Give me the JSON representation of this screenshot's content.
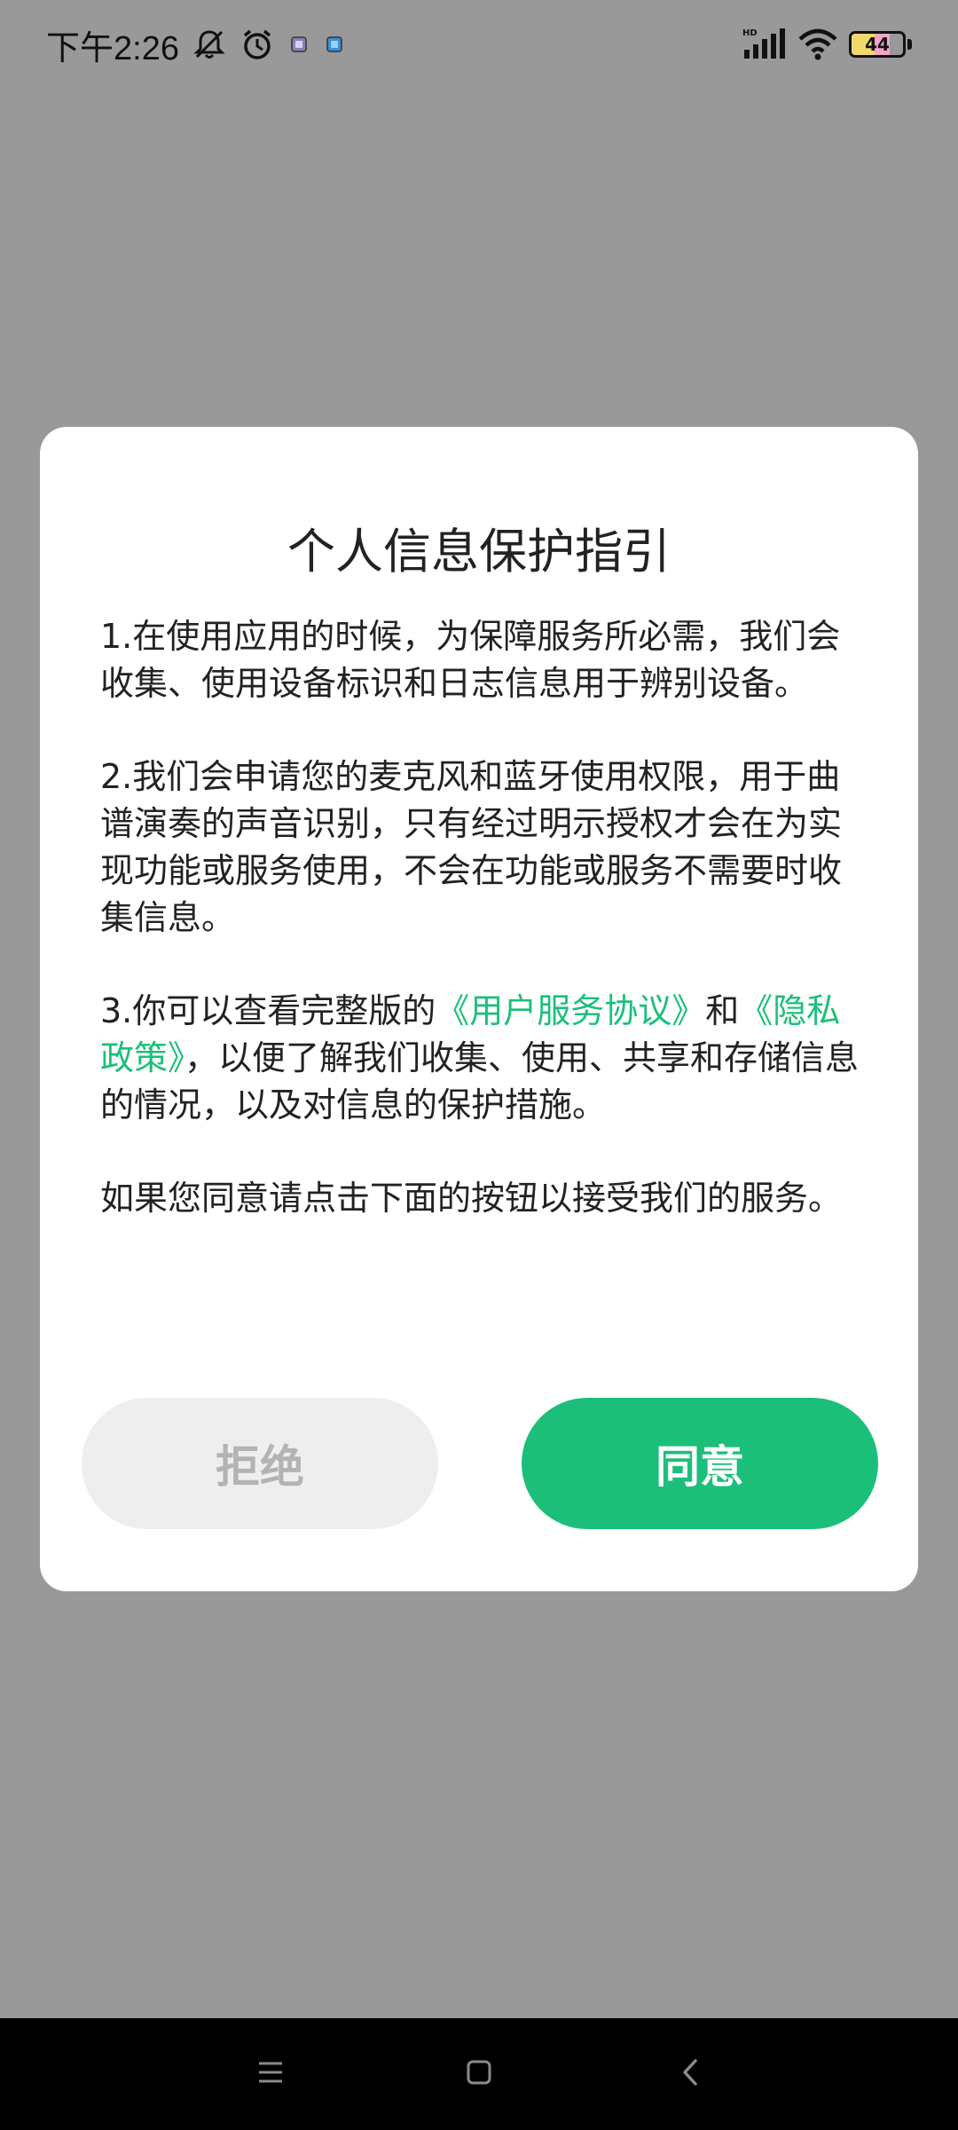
{
  "status_bar": {
    "time": "下午2:26",
    "battery_level": "44",
    "icons": [
      "mute-bell-icon",
      "alarm-icon",
      "app-notification-icon",
      "app-notification-icon-2",
      "hd-signal-icon",
      "wifi-icon",
      "battery-icon"
    ]
  },
  "dialog": {
    "title": "个人信息保护指引",
    "para1": "1.在使用应用的时候，为保障服务所必需，我们会收集、使用设备标识和日志信息用于辨别设备。",
    "para2": "2.我们会申请您的麦克风和蓝牙使用权限，用于曲谱演奏的声音识别，只有经过明示授权才会在为实现功能或服务使用，不会在功能或服务不需要时收集信息。",
    "para3": {
      "prefix": "3.你可以查看完整版的",
      "user_agreement_link": "《用户服务协议》",
      "and": "和",
      "privacy_policy_link": "《隐私政策》",
      "suffix": "，以便了解我们收集、使用、共享和存储信息的情况，以及对信息的保护措施。"
    },
    "para4": "如果您同意请点击下面的按钮以接受我们的服务。",
    "reject_label": "拒绝",
    "agree_label": "同意"
  },
  "colors": {
    "backdrop": "#999999",
    "accent": "#1cbf7a",
    "reject_bg": "#eeeeee",
    "reject_text": "#b3b3b3"
  },
  "nav_bar": {
    "icons": [
      "menu-icon",
      "home-icon",
      "back-icon"
    ]
  }
}
